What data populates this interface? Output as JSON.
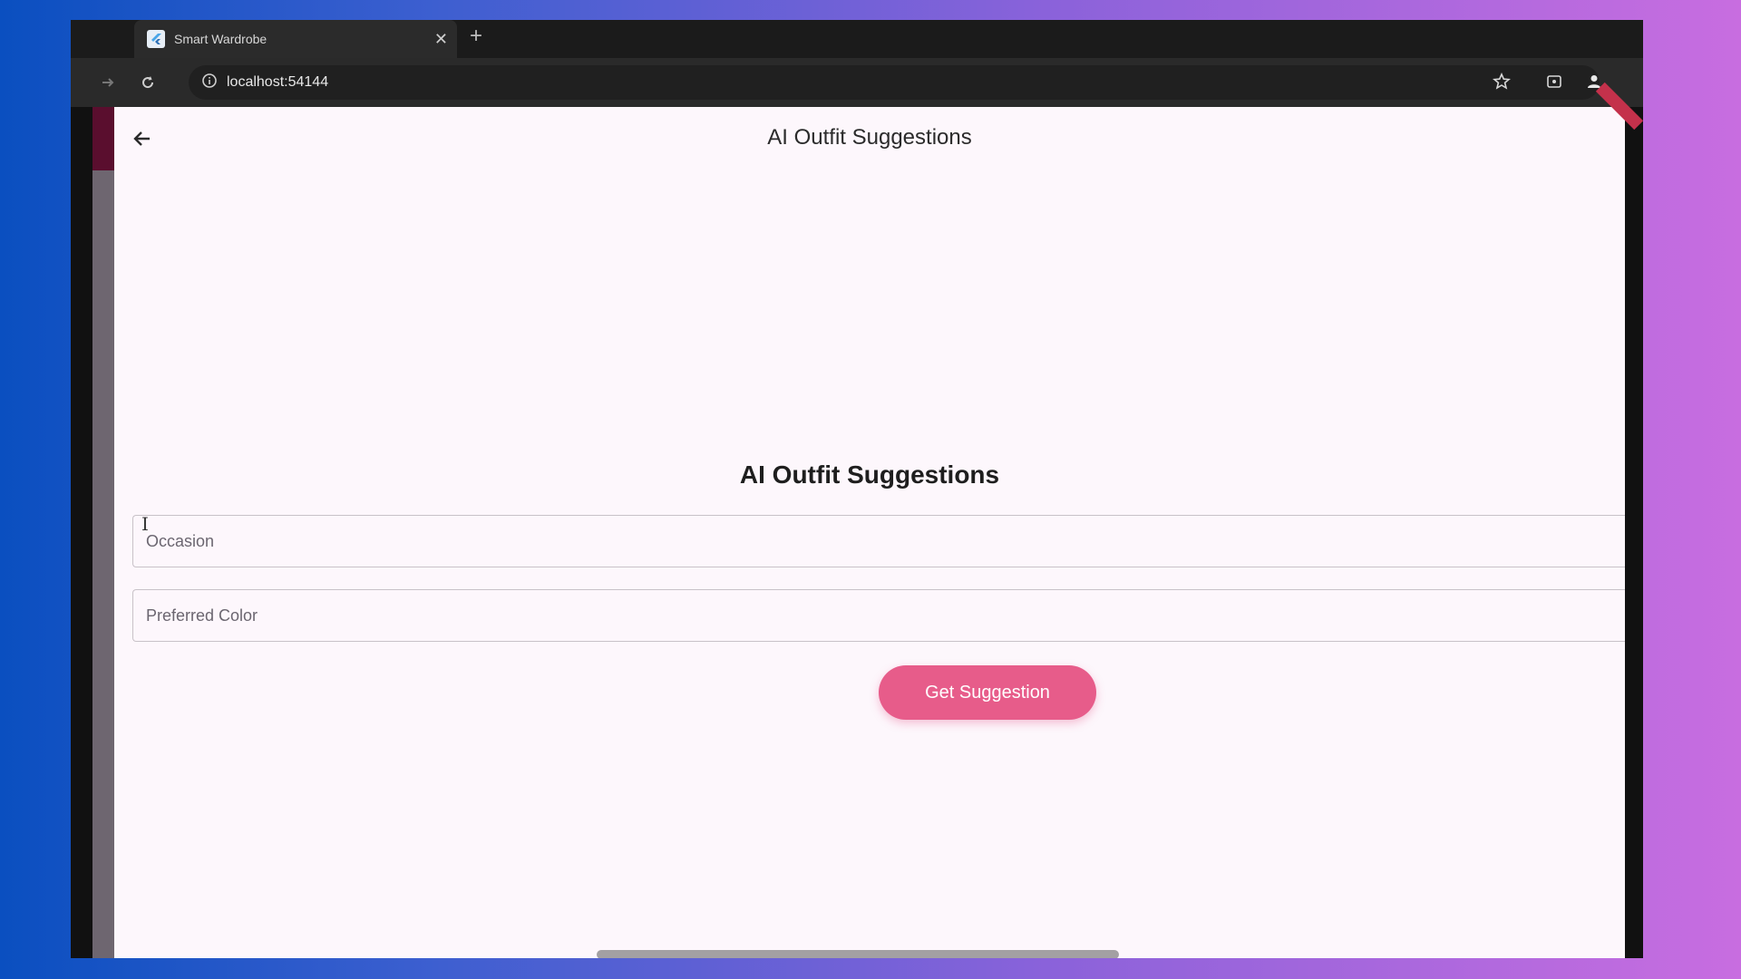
{
  "browser": {
    "tab_title": "Smart Wardrobe",
    "url": "localhost:54144"
  },
  "app": {
    "appbar_title": "AI Outfit Suggestions",
    "section_title": "AI Outfit Suggestions",
    "occasion_field": {
      "placeholder": "Occasion",
      "value": ""
    },
    "color_field": {
      "placeholder": "Preferred Color",
      "value": ""
    },
    "submit_label": "Get Suggestion"
  },
  "colors": {
    "accent": "#e75c8a",
    "page_background": "#fdf7fc"
  }
}
